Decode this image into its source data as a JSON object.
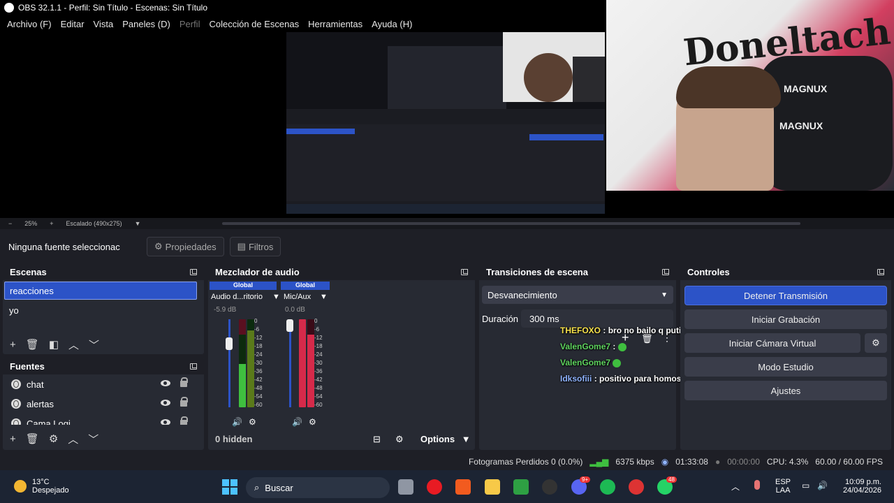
{
  "window": {
    "title": "OBS 32.1.1 - Perfil: Sin Título - Escenas: Sin Título"
  },
  "menu": [
    "Archivo (F)",
    "Editar",
    "Vista",
    "Paneles (D)",
    "Perfil",
    "Colección de Escenas",
    "Herramientas",
    "Ayuda (H)"
  ],
  "preview_bar": {
    "zoom": "25%",
    "scale": "Escalado (490x275)"
  },
  "webcam_text": {
    "logo": "Doneltach",
    "chair_brand": "MAGNUX"
  },
  "props": {
    "no_source": "Ninguna fuente seleccionac",
    "properties": "Propiedades",
    "filters": "Filtros"
  },
  "scenes": {
    "title": "Escenas",
    "items": [
      "reacciones",
      "yo"
    ]
  },
  "sources": {
    "title": "Fuentes",
    "items": [
      "chat",
      "alertas",
      "Cama Logi"
    ]
  },
  "mixer": {
    "title": "Mezclador de audio",
    "channels": [
      {
        "tag": "Global",
        "name": "Audio d...ritorio",
        "db": "-5.9 dB"
      },
      {
        "tag": "Global",
        "name": "Mic/Aux",
        "db": "0.0 dB"
      }
    ],
    "scale": [
      "0",
      "-6",
      "-12",
      "-18",
      "-24",
      "-30",
      "-36",
      "-42",
      "-48",
      "-54",
      "-60"
    ],
    "hidden": "0 hidden",
    "options": "Options"
  },
  "transitions": {
    "title": "Transiciones de escena",
    "selected": "Desvanecimiento",
    "duration_label": "Duración",
    "duration_value": "300 ms"
  },
  "controls": {
    "title": "Controles",
    "buttons": [
      "Detener Transmisión",
      "Iniciar Grabación",
      "Iniciar Cámara Virtual",
      "Modo Estudio",
      "Ajustes"
    ]
  },
  "chat": [
    {
      "user": "THEFOXO",
      "text": ": bro no bailo q putix",
      "color": "#f6e14b"
    },
    {
      "user": "ValenGome7",
      "text": ":",
      "color": "#5ed35e"
    },
    {
      "user": "ValenGome7",
      "text": ":",
      "color": "#5ed35e"
    },
    {
      "user": "Idksofiii",
      "text": ": positivo para homosexual",
      "color": "#8fb3ff"
    }
  ],
  "status": {
    "dropped": "Fotogramas Perdidos 0 (0.0%)",
    "bitrate": "6375 kbps",
    "stream_time": "01:33:08",
    "rec_time": "00:00:00",
    "cpu": "CPU: 4.3%",
    "fps": "60.00 / 60.00 FPS"
  },
  "taskbar": {
    "weather_temp": "13°C",
    "weather_desc": "Despejado",
    "search": "Buscar",
    "lang1": "ESP",
    "lang2": "LAA",
    "time": "10:09 p.m.",
    "date": "24/04/2026",
    "discord_badge": "9+",
    "whatsapp_badge": "48"
  },
  "colors": {
    "accent": "#2c53c7",
    "panel": "#272a33",
    "bg": "#1e1f26"
  }
}
